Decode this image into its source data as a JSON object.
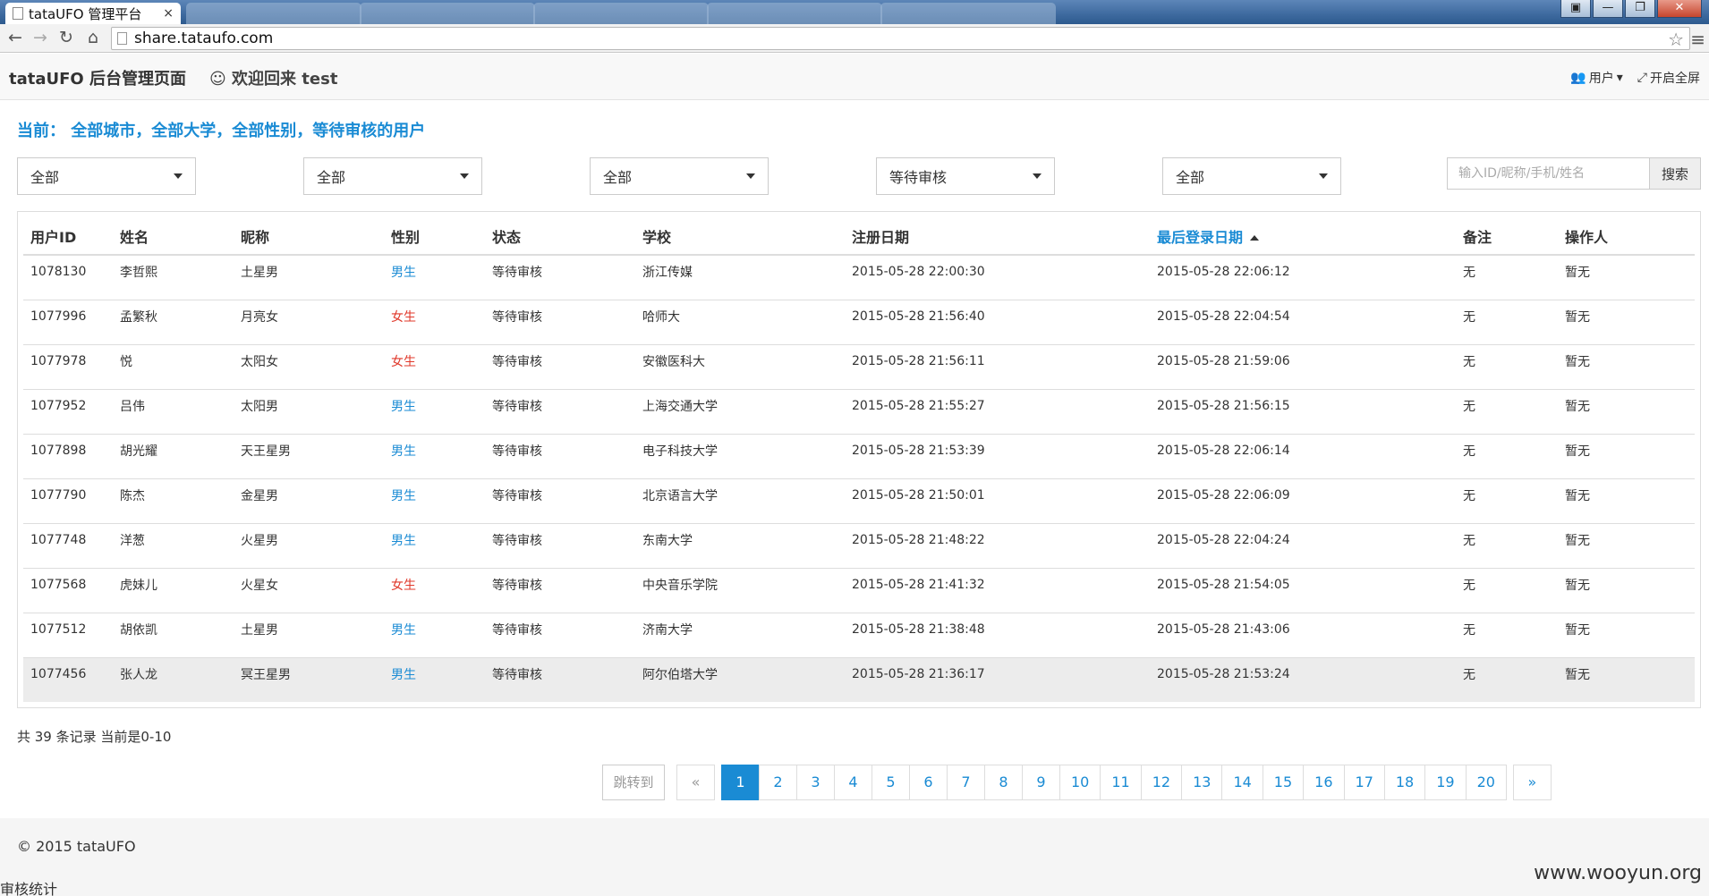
{
  "browser": {
    "active_tab_title": "tataUFO 管理平台",
    "url": "share.tataufo.com",
    "window_buttons": [
      "▣",
      "—",
      "❐",
      "✕"
    ]
  },
  "header": {
    "brand": "tataUFO 后台管理页面",
    "welcome": "☺ 欢迎回来 test",
    "user_menu": "用户",
    "fullscreen": "开启全屏"
  },
  "filters": {
    "current_label": "当前： 全部城市，全部大学，全部性别，等待审核的用户",
    "selects": [
      "全部",
      "全部",
      "全部",
      "等待审核",
      "全部"
    ],
    "search_placeholder": "输入ID/昵称/手机/姓名",
    "search_button": "搜索"
  },
  "table": {
    "headers": [
      "用户ID",
      "姓名",
      "昵称",
      "性别",
      "状态",
      "学校",
      "注册日期",
      "最后登录日期",
      "备注",
      "操作人"
    ],
    "sorted_column": 7,
    "rows": [
      [
        "1078130",
        "李哲熙",
        "土星男",
        "男生",
        "等待审核",
        "浙江传媒",
        "2015-05-28 22:00:30",
        "2015-05-28 22:06:12",
        "无",
        "暂无"
      ],
      [
        "1077996",
        "孟繁秋",
        "月亮女",
        "女生",
        "等待审核",
        "哈师大",
        "2015-05-28 21:56:40",
        "2015-05-28 22:04:54",
        "无",
        "暂无"
      ],
      [
        "1077978",
        "悦",
        "太阳女",
        "女生",
        "等待审核",
        "安徽医科大",
        "2015-05-28 21:56:11",
        "2015-05-28 21:59:06",
        "无",
        "暂无"
      ],
      [
        "1077952",
        "吕伟",
        "太阳男",
        "男生",
        "等待审核",
        "上海交通大学",
        "2015-05-28 21:55:27",
        "2015-05-28 21:56:15",
        "无",
        "暂无"
      ],
      [
        "1077898",
        "胡光耀",
        "天王星男",
        "男生",
        "等待审核",
        "电子科技大学",
        "2015-05-28 21:53:39",
        "2015-05-28 22:06:14",
        "无",
        "暂无"
      ],
      [
        "1077790",
        "陈杰",
        "金星男",
        "男生",
        "等待审核",
        "北京语言大学",
        "2015-05-28 21:50:01",
        "2015-05-28 22:06:09",
        "无",
        "暂无"
      ],
      [
        "1077748",
        "洋葱",
        "火星男",
        "男生",
        "等待审核",
        "东南大学",
        "2015-05-28 21:48:22",
        "2015-05-28 22:04:24",
        "无",
        "暂无"
      ],
      [
        "1077568",
        "虎妹儿",
        "火星女",
        "女生",
        "等待审核",
        "中央音乐学院",
        "2015-05-28 21:41:32",
        "2015-05-28 21:54:05",
        "无",
        "暂无"
      ],
      [
        "1077512",
        "胡依凯",
        "土星男",
        "男生",
        "等待审核",
        "济南大学",
        "2015-05-28 21:38:48",
        "2015-05-28 21:43:06",
        "无",
        "暂无"
      ],
      [
        "1077456",
        "张人龙",
        "冥王星男",
        "男生",
        "等待审核",
        "阿尔伯塔大学",
        "2015-05-28 21:36:17",
        "2015-05-28 21:53:24",
        "无",
        "暂无"
      ]
    ],
    "highlighted_row": 9
  },
  "pagination": {
    "summary": "共 39 条记录 当前是0-10",
    "jump_label": "跳转到",
    "prev": "«",
    "next": "»",
    "pages": [
      "1",
      "2",
      "3",
      "4",
      "5",
      "6",
      "7",
      "8",
      "9",
      "10",
      "11",
      "12",
      "13",
      "14",
      "15",
      "16",
      "17",
      "18",
      "19",
      "20"
    ],
    "current_page": "1"
  },
  "footer": {
    "copyright": "© 2015 tataUFO",
    "stats_link": "审核统计",
    "watermark": "www.wooyun.org"
  },
  "colors": {
    "accent": "#1a8bd4",
    "female": "#e0392b"
  }
}
